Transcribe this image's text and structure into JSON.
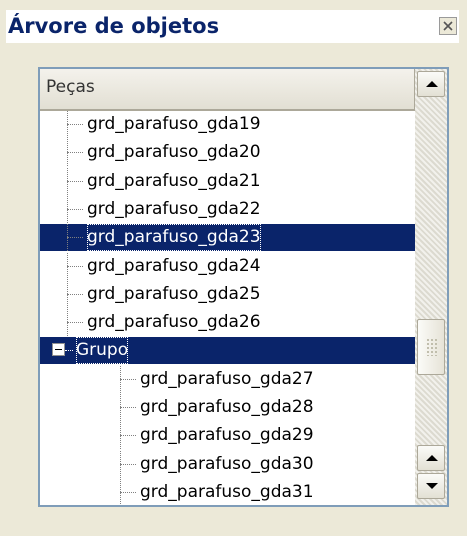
{
  "window": {
    "title": "Árvore de objetos"
  },
  "tree": {
    "column_header": "Peças",
    "rows": [
      {
        "label": "grd_parafuso_gda19",
        "level": 1,
        "selected": false
      },
      {
        "label": "grd_parafuso_gda20",
        "level": 1,
        "selected": false
      },
      {
        "label": "grd_parafuso_gda21",
        "level": 1,
        "selected": false
      },
      {
        "label": "grd_parafuso_gda22",
        "level": 1,
        "selected": false
      },
      {
        "label": "grd_parafuso_gda23",
        "level": 1,
        "selected": true
      },
      {
        "label": "grd_parafuso_gda24",
        "level": 1,
        "selected": false
      },
      {
        "label": "grd_parafuso_gda25",
        "level": 1,
        "selected": false
      },
      {
        "label": "grd_parafuso_gda26",
        "level": 1,
        "selected": false
      },
      {
        "label": "Grupo",
        "level": 0,
        "selected": true,
        "expanded": true
      },
      {
        "label": "grd_parafuso_gda27",
        "level": 2,
        "selected": false
      },
      {
        "label": "grd_parafuso_gda28",
        "level": 2,
        "selected": false
      },
      {
        "label": "grd_parafuso_gda29",
        "level": 2,
        "selected": false
      },
      {
        "label": "grd_parafuso_gda30",
        "level": 2,
        "selected": false
      },
      {
        "label": "grd_parafuso_gda31",
        "level": 2,
        "selected": false
      }
    ]
  },
  "colors": {
    "selection": "#0a246a",
    "title_text": "#0a246a",
    "panel_bg": "#ece9d8",
    "frame_border": "#7f9db9"
  },
  "icons": {
    "close": "close-icon",
    "scroll_up": "arrow-up-icon",
    "scroll_down": "arrow-down-icon",
    "expander": "minus-box-icon"
  }
}
